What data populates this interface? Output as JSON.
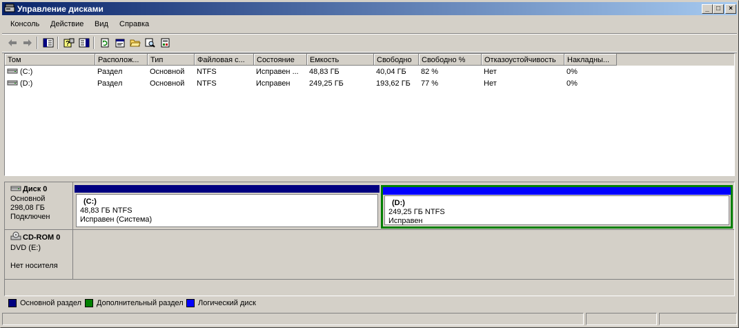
{
  "window": {
    "title": "Управление дисками"
  },
  "menu": [
    "Консоль",
    "Действие",
    "Вид",
    "Справка"
  ],
  "toolbar": {
    "buttons": [
      "back-icon",
      "forward-icon",
      "show-hide-console-tree-icon",
      "help-icon",
      "show-hide-action-pane-icon",
      "refresh-icon",
      "properties-icon",
      "open-folder-icon",
      "search-icon",
      "export-icon"
    ]
  },
  "volume_list": {
    "columns": [
      "Том",
      "Располож...",
      "Тип",
      "Файловая с...",
      "Состояние",
      "Емкость",
      "Свободно",
      "Свободно %",
      "Отказоустойчивость",
      "Накладны..."
    ],
    "rows": [
      {
        "volume": "(C:)",
        "layout": "Раздел",
        "type": "Основной",
        "fs": "NTFS",
        "status": "Исправен ...",
        "capacity": "48,83 ГБ",
        "free": "40,04 ГБ",
        "free_pct": "82 %",
        "fault": "Нет",
        "overhead": "0%"
      },
      {
        "volume": "(D:)",
        "layout": "Раздел",
        "type": "Основной",
        "fs": "NTFS",
        "status": "Исправен",
        "capacity": "249,25 ГБ",
        "free": "193,62 ГБ",
        "free_pct": "77 %",
        "fault": "Нет",
        "overhead": "0%"
      }
    ]
  },
  "disks": [
    {
      "name": "Диск 0",
      "kind": "Основной",
      "size": "298,08 ГБ",
      "state": "Подключен",
      "partitions": [
        {
          "label": "(C:)",
          "size_fs": "48,83 ГБ NTFS",
          "status": "Исправен (Система)",
          "color": "#000080",
          "selected": false
        },
        {
          "label": "(D:)",
          "size_fs": "249,25 ГБ NTFS",
          "status": "Исправен",
          "color": "#0000ff",
          "selected": true
        }
      ]
    },
    {
      "name": "CD-ROM 0",
      "kind": "DVD (E:)",
      "size": "",
      "state": "Нет носителя"
    }
  ],
  "legend": [
    {
      "label": "Основной раздел",
      "color": "#000080"
    },
    {
      "label": "Дополнительный раздел",
      "color": "#008000"
    },
    {
      "label": "Логический диск",
      "color": "#0000ff"
    }
  ],
  "colors": {
    "selection_border": "#008000"
  }
}
